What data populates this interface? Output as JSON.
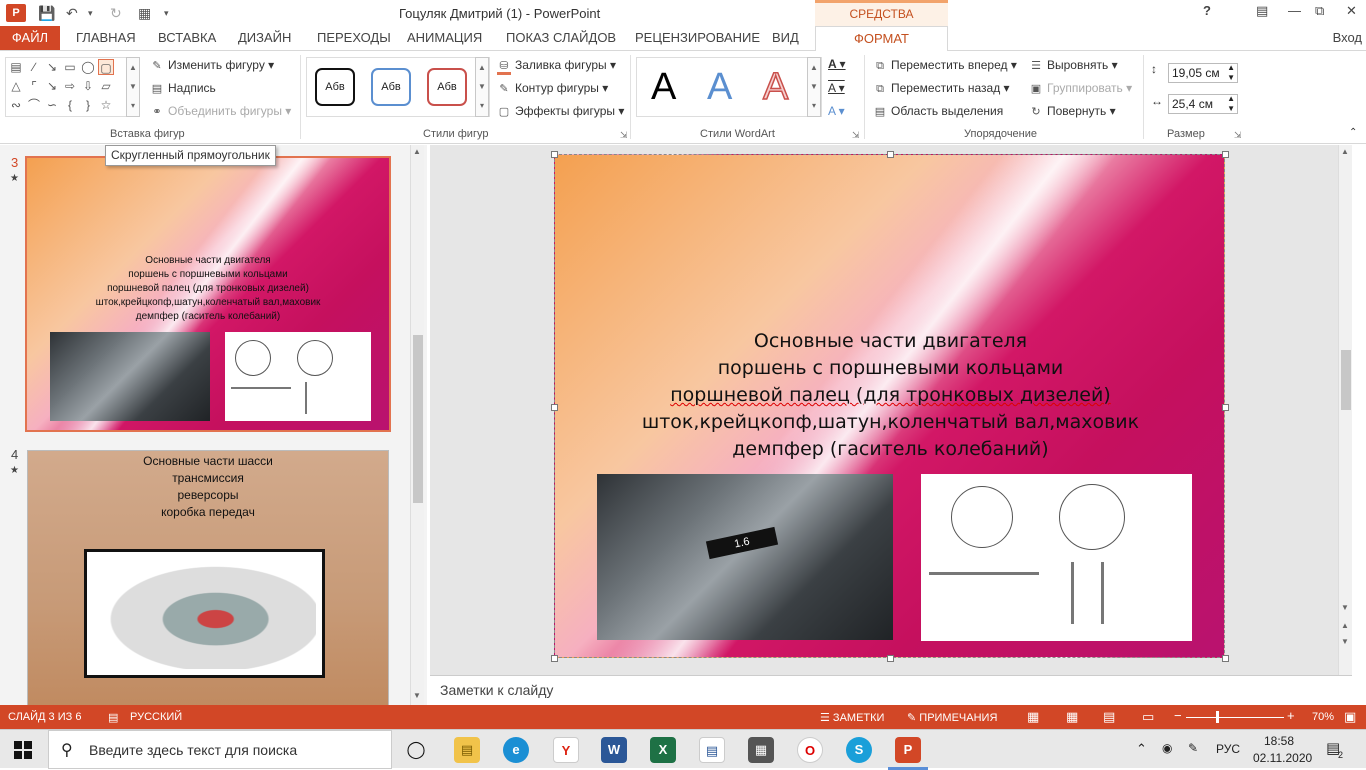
{
  "window": {
    "title": "Гоцуляк Дмитрий (1) - PowerPoint",
    "context_group": "СРЕДСТВА РИСОВАНИЯ",
    "help": "?",
    "signin": "Вход"
  },
  "tabs": [
    "ФАЙЛ",
    "ГЛАВНАЯ",
    "ВСТАВКА",
    "ДИЗАЙН",
    "ПЕРЕХОДЫ",
    "АНИМАЦИЯ",
    "ПОКАЗ СЛАЙДОВ",
    "РЕЦЕНЗИРОВАНИЕ",
    "ВИД",
    "ФОРМАТ"
  ],
  "ribbon": {
    "insert_shapes": {
      "label": "Вставка фигур",
      "edit_shape": "Изменить фигуру",
      "text_box": "Надпись",
      "merge_shapes": "Объединить фигуры"
    },
    "shape_styles": {
      "label": "Стили фигур",
      "sample": "Абв",
      "fill": "Заливка фигуры",
      "outline": "Контур фигуры",
      "effects": "Эффекты фигуры"
    },
    "wordart": {
      "label": "Стили WordArt",
      "letter": "A"
    },
    "arrange": {
      "label": "Упорядочение",
      "bring_forward": "Переместить вперед",
      "send_backward": "Переместить назад",
      "selection_pane": "Область выделения",
      "align": "Выровнять",
      "group": "Группировать",
      "rotate": "Повернуть"
    },
    "size": {
      "label": "Размер",
      "height": "19,05 см",
      "width": "25,4 см"
    }
  },
  "tooltip": "Скругленный прямоугольник",
  "thumbnails": [
    {
      "num": "3",
      "lines": [
        "Основные части двигателя",
        "поршень с поршневыми кольцами",
        "поршневой палец (для тронковых дизелей)",
        "шток,крейцкопф,шатун,коленчатый вал,маховик",
        "демпфер (гаситель колебаний)"
      ]
    },
    {
      "num": "4",
      "lines": [
        "Основные части шасси",
        "трансмиссия",
        "реверсоры",
        "коробка передач"
      ]
    }
  ],
  "slide": {
    "lines": [
      "Основные части двигателя",
      "поршень с поршневыми кольцами",
      "поршневой палец (для тронковых дизелей)",
      "шток,крейцкопф,шатун,коленчатый вал,маховик",
      "демпфер (гаситель колебаний)"
    ],
    "badge": "1.6"
  },
  "notes_placeholder": "Заметки к слайду",
  "status": {
    "slide_of": "СЛАЙД 3 ИЗ 6",
    "language": "РУССКИЙ",
    "notes": "ЗАМЕТКИ",
    "comments": "ПРИМЕЧАНИЯ",
    "zoom": "70%"
  },
  "taskbar": {
    "search_placeholder": "Введите здесь текст для поиска",
    "lang": "РУС",
    "time": "18:58",
    "date": "02.11.2020",
    "notif_count": "2"
  }
}
